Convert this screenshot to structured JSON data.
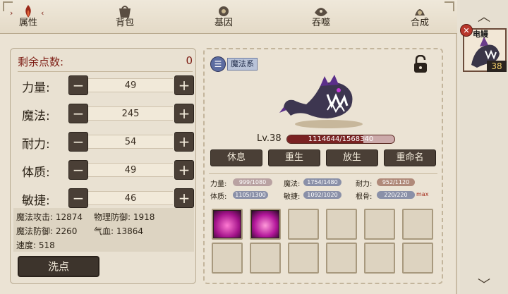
{
  "tabs": [
    {
      "label": "属性",
      "icon": "flame-icon"
    },
    {
      "label": "背包",
      "icon": "bag-icon"
    },
    {
      "label": "基因",
      "icon": "gene-icon"
    },
    {
      "label": "吞噬",
      "icon": "devour-icon"
    },
    {
      "label": "合成",
      "icon": "synthesis-icon"
    }
  ],
  "points": {
    "label": "剩余点数:",
    "value": "0"
  },
  "stats": [
    {
      "label": "力量:",
      "value": "49"
    },
    {
      "label": "魔法:",
      "value": "245"
    },
    {
      "label": "耐力:",
      "value": "54"
    },
    {
      "label": "体质:",
      "value": "49"
    },
    {
      "label": "敏捷:",
      "value": "46"
    }
  ],
  "derived": {
    "matk": "魔法攻击: 12874",
    "pdef": "物理防御: 1918",
    "mdef": "魔法防御: 2260",
    "hp": "气血: 13864",
    "speed": "速度: 518"
  },
  "reset_label": "洗点",
  "pet": {
    "type": "魔法系",
    "level": "Lv.38",
    "hp_text": "1114644/1568340",
    "hp_fraction": 0.711,
    "card_name": "电鳗",
    "card_level": "38"
  },
  "actions": [
    "休息",
    "重生",
    "放生",
    "重命名"
  ],
  "aptitude": [
    {
      "label": "力量:",
      "value": "999/1080",
      "color": "#b9a2a2"
    },
    {
      "label": "魔法:",
      "value": "1754/1480",
      "color": "#8a90a8"
    },
    {
      "label": "耐力:",
      "value": "952/1120",
      "color": "#b08a7a"
    },
    {
      "label": "体质:",
      "value": "1105/1300",
      "color": "#8a90a8"
    },
    {
      "label": "敏捷:",
      "value": "1092/1020",
      "color": "#8a90a8"
    },
    {
      "label": "根骨:",
      "value": "220/220",
      "color": "#8a90a8"
    }
  ],
  "max_label": "max"
}
